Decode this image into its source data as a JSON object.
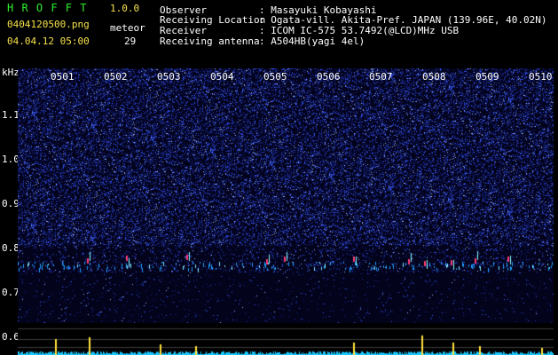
{
  "app": {
    "title": "H R O F F T",
    "version": "1.0.0"
  },
  "file": {
    "name": "0404120500.png",
    "timestamp": "04.04.12 05:00"
  },
  "meteor": {
    "label": "meteor",
    "count": "29"
  },
  "info": [
    {
      "key": "Observer",
      "value": ": Masayuki Kobayashi"
    },
    {
      "key": "Receiving Location",
      "value": ": Ogata-vill. Akita-Pref. JAPAN (139.96E, 40.02N)"
    },
    {
      "key": "Receiver",
      "value": ": ICOM IC-575 53.7492(@LCD)MHz USB"
    },
    {
      "key": "Receiving antenna",
      "value": ": A504HB(yagi 4el)"
    }
  ],
  "axis": {
    "unit": "kHz",
    "y_ticks": [
      "1.1",
      "1.0",
      "0.9",
      "0.8",
      "0.7",
      "0.6"
    ],
    "time_ticks": [
      "0501",
      "0502",
      "0503",
      "0504",
      "0505",
      "0506",
      "0507",
      "0508",
      "0509",
      "0510"
    ]
  },
  "colors": {
    "green": "#2cf02c",
    "yellow": "#f5e14a",
    "noise": "#3a5cff",
    "signal": "#19c8ff",
    "spike": "#ffe23b"
  }
}
